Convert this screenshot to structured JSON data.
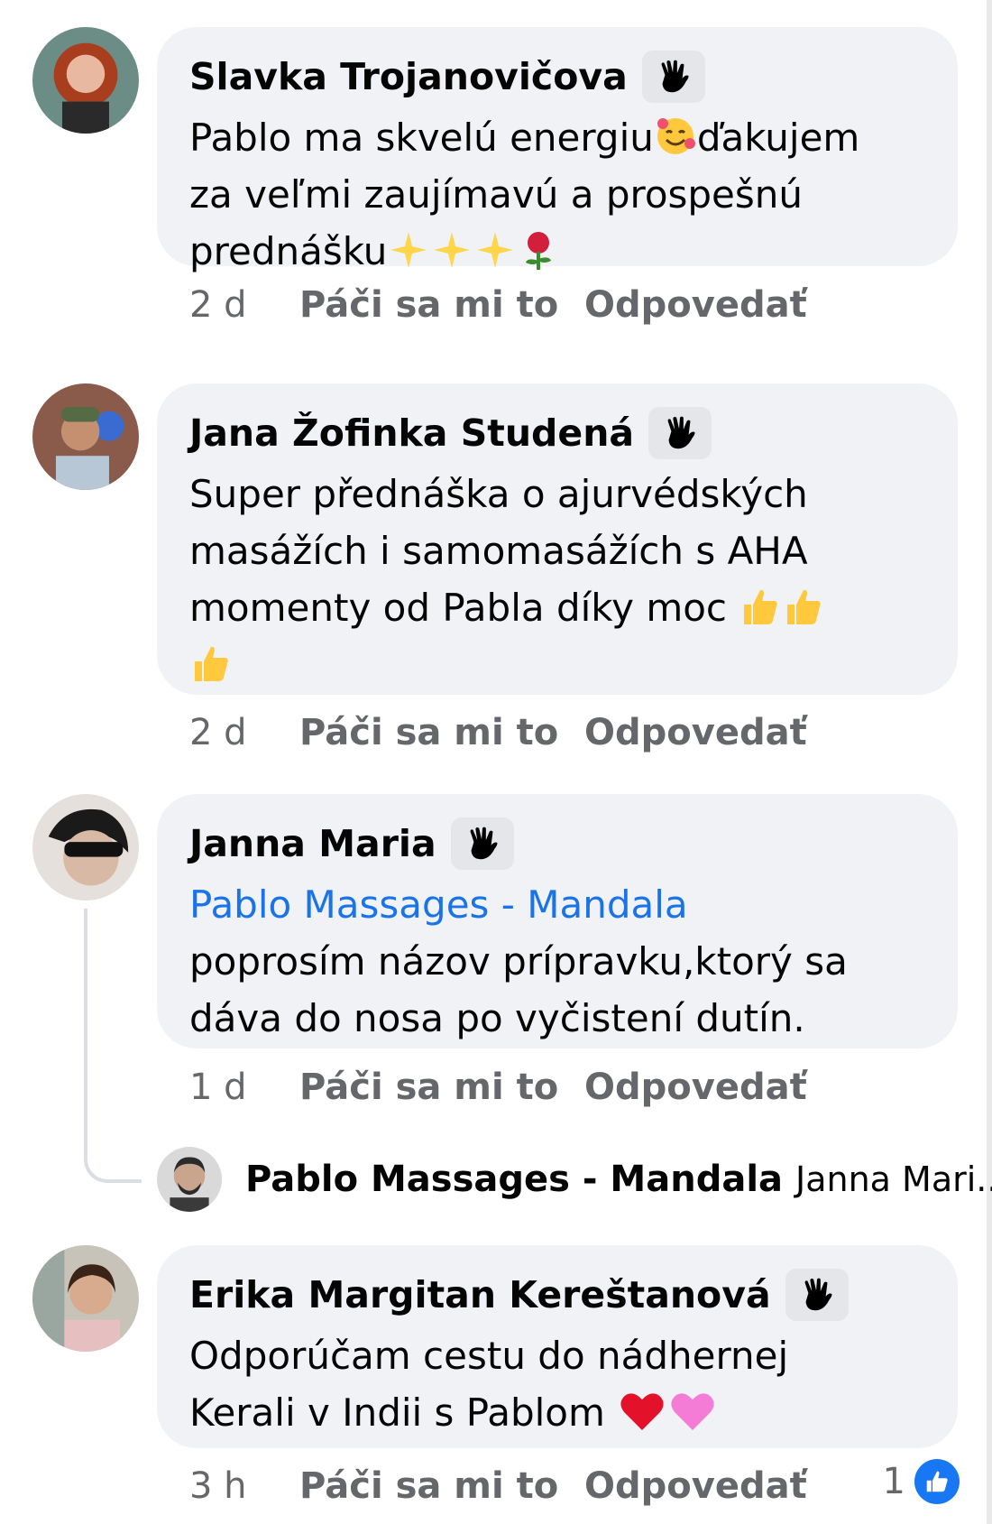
{
  "actions": {
    "like_label": "Páči sa mi to",
    "reply_label": "Odpovedať"
  },
  "comments": [
    {
      "author": "Slavka Trojanovičova",
      "text_1": "Pablo ma skvelú energiu",
      "text_2": "ďakujem",
      "text_3": "za  veľmi zaujímavú a prospešnú",
      "text_4": "prednášku",
      "time": "2 d"
    },
    {
      "author": "Jana Žofinka Studená",
      "text_1": "Super přednáška o ajurvédských",
      "text_2": "masážích i samomasážích  s AHA",
      "text_3": "momenty od Pabla díky moc",
      "time": "2 d"
    },
    {
      "author": "Janna Maria",
      "mention": "Pablo Massages - Mandala",
      "text_1": "poprosím názov prípravku,ktorý sa",
      "text_2": "dáva do nosa po vyčistení dutín.",
      "time": "1 d"
    },
    {
      "author": "Erika Margitan Kereštanová",
      "text_1": "Odporúčam cestu do nádhernej",
      "text_2": "Kerali v Indii s Pablom",
      "time": "3 h",
      "reaction_count": "1"
    }
  ],
  "reply": {
    "author": "Pablo Massages - Mandala",
    "preview": "Janna Mari..."
  },
  "icons": {
    "wave": "waving-hand-icon",
    "smile": "smiling-face-with-hearts-icon",
    "sparkles": "sparkles-icon",
    "rose": "rose-icon",
    "thumbs": "thumbs-up-icon",
    "heart_red": "red-heart-icon",
    "heart_pink": "pink-heart-icon",
    "like_badge": "like-badge-icon"
  },
  "colors": {
    "bubble": "#f0f2f5",
    "meta": "#65676b",
    "mention": "#1a73e8",
    "like_blue": "#1877f2"
  }
}
